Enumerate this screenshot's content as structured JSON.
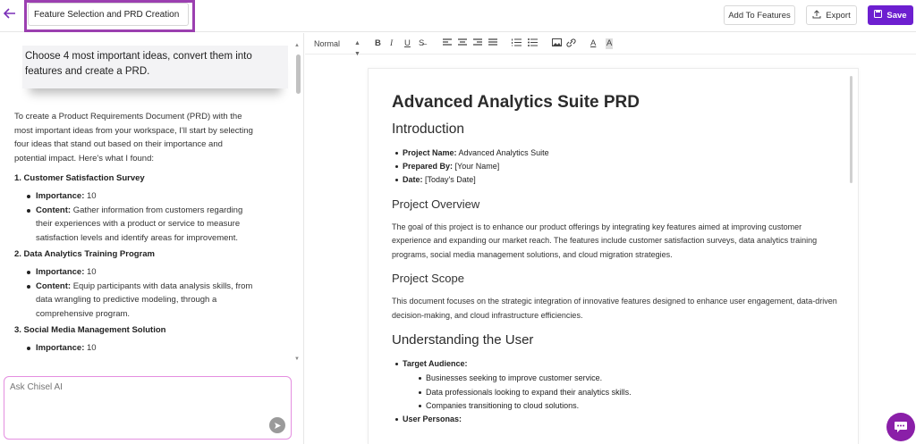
{
  "header": {
    "title_value": "Feature Selection and PRD Creation",
    "add_to_features": "Add To Features",
    "export": "Export",
    "save": "Save"
  },
  "colors": {
    "accent": "#6d1fd0",
    "highlight_border": "#9b3fb0",
    "ask_border": "#e48ee0",
    "chat_bubble": "#8a1fa8"
  },
  "chat": {
    "prompt": "Choose 4 most important ideas, convert them into features and create a PRD.",
    "intro": "To create a Product Requirements Document (PRD) with the most important ideas from your workspace, I'll start by selecting four ideas that stand out based on their importance and potential impact. Here's what I found:",
    "ideas": [
      {
        "title": "1. Customer Satisfaction Survey",
        "importance_label": "Importance:",
        "importance": "10",
        "content_label": "Content:",
        "content": "Gather information from customers regarding their experiences with a product or service to measure satisfaction levels and identify areas for improvement."
      },
      {
        "title": "2. Data Analytics Training Program",
        "importance_label": "Importance:",
        "importance": "10",
        "content_label": "Content:",
        "content": "Equip participants with data analysis skills, from data wrangling to predictive modeling, through a comprehensive program."
      },
      {
        "title": "3. Social Media Management Solution",
        "importance_label": "Importance:",
        "importance": "10"
      }
    ],
    "ask_placeholder": "Ask Chisel AI"
  },
  "toolbar": {
    "style_select": "Normal",
    "icons": [
      "bold-icon",
      "italic-icon",
      "underline-icon",
      "strikethrough-icon",
      "align-left-icon",
      "align-center-icon",
      "align-right-icon",
      "align-justify-icon",
      "ordered-list-icon",
      "bullet-list-icon",
      "image-icon",
      "link-icon",
      "text-color-icon",
      "highlight-icon"
    ]
  },
  "doc": {
    "title": "Advanced Analytics Suite PRD",
    "intro_heading": "Introduction",
    "intro_items": [
      {
        "label": "Project Name:",
        "value": "Advanced Analytics Suite"
      },
      {
        "label": "Prepared By:",
        "value": "[Your Name]"
      },
      {
        "label": "Date:",
        "value": "[Today's Date]"
      }
    ],
    "overview_heading": "Project Overview",
    "overview_text": "The goal of this project is to enhance our product offerings by integrating key features aimed at improving customer experience and expanding our market reach. The features include customer satisfaction surveys, data analytics training programs, social media management solutions, and cloud migration strategies.",
    "scope_heading": "Project Scope",
    "scope_text": "This document focuses on the strategic integration of innovative features designed to enhance user engagement, data-driven decision-making, and cloud infrastructure efficiencies.",
    "user_heading": "Understanding the User",
    "target_label": "Target Audience:",
    "target_items": [
      "Businesses seeking to improve customer service.",
      "Data professionals looking to expand their analytics skills.",
      "Companies transitioning to cloud solutions."
    ],
    "personas_label": "User Personas:"
  }
}
